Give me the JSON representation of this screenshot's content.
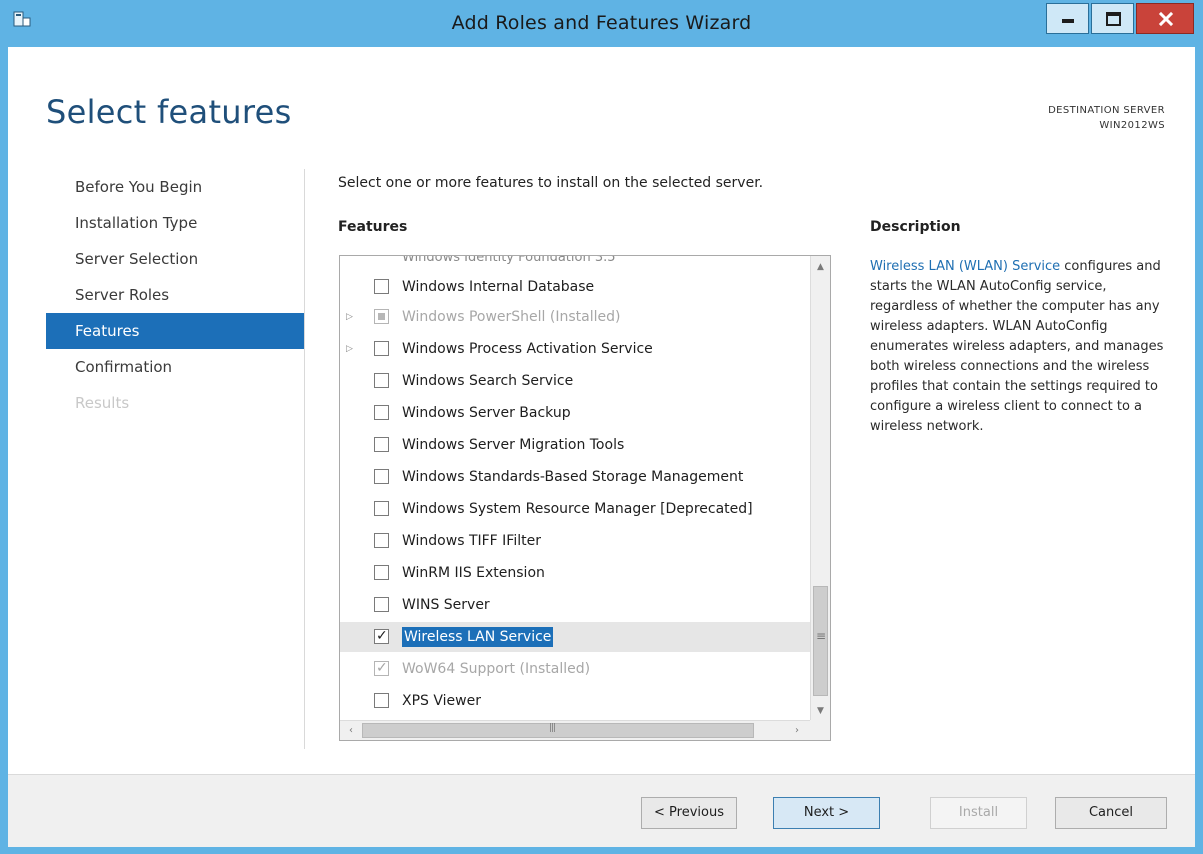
{
  "window": {
    "title": "Add Roles and Features Wizard"
  },
  "page": {
    "title": "Select features",
    "destination_label": "DESTINATION SERVER",
    "destination_server": "WIN2012WS"
  },
  "nav": {
    "items": [
      {
        "label": "Before You Begin",
        "state": "normal"
      },
      {
        "label": "Installation Type",
        "state": "normal"
      },
      {
        "label": "Server Selection",
        "state": "normal"
      },
      {
        "label": "Server Roles",
        "state": "normal"
      },
      {
        "label": "Features",
        "state": "active"
      },
      {
        "label": "Confirmation",
        "state": "normal"
      },
      {
        "label": "Results",
        "state": "disabled"
      }
    ]
  },
  "content": {
    "instruction": "Select one or more features to install on the selected server.",
    "features_heading": "Features",
    "description_heading": "Description"
  },
  "features": [
    {
      "label": "Windows Identity Foundation 3.5",
      "checked": false,
      "state": "cut"
    },
    {
      "label": "Windows Internal Database",
      "checked": false,
      "state": "normal"
    },
    {
      "label": "Windows PowerShell (Installed)",
      "checked": false,
      "state": "installed-partial",
      "expandable": true
    },
    {
      "label": "Windows Process Activation Service",
      "checked": false,
      "state": "normal",
      "expandable": true
    },
    {
      "label": "Windows Search Service",
      "checked": false,
      "state": "normal"
    },
    {
      "label": "Windows Server Backup",
      "checked": false,
      "state": "normal"
    },
    {
      "label": "Windows Server Migration Tools",
      "checked": false,
      "state": "normal"
    },
    {
      "label": "Windows Standards-Based Storage Management",
      "checked": false,
      "state": "normal"
    },
    {
      "label": "Windows System Resource Manager [Deprecated]",
      "checked": false,
      "state": "normal"
    },
    {
      "label": "Windows TIFF IFilter",
      "checked": false,
      "state": "normal"
    },
    {
      "label": "WinRM IIS Extension",
      "checked": false,
      "state": "normal"
    },
    {
      "label": "WINS Server",
      "checked": false,
      "state": "normal"
    },
    {
      "label": "Wireless LAN Service",
      "checked": true,
      "state": "selected"
    },
    {
      "label": "WoW64 Support (Installed)",
      "checked": true,
      "state": "installed"
    },
    {
      "label": "XPS Viewer",
      "checked": false,
      "state": "normal"
    }
  ],
  "description": {
    "link": "Wireless LAN (WLAN) Service",
    "text": " configures and starts the WLAN AutoConfig service, regardless of whether the computer has any wireless adapters. WLAN AutoConfig enumerates wireless adapters, and manages both wireless connections and the wireless profiles that contain the settings required to configure a wireless client to connect to a wireless network."
  },
  "buttons": {
    "previous": "< Previous",
    "next": "Next >",
    "install": "Install",
    "cancel": "Cancel"
  },
  "icons": {
    "app": "server-manager-icon",
    "minimize": "minimize-icon",
    "maximize": "maximize-icon",
    "close": "close-icon"
  },
  "colors": {
    "title_bar": "#5fb3e4",
    "accent": "#1c6fb8",
    "heading": "#1f4f7a",
    "close_button": "#c9433a"
  }
}
